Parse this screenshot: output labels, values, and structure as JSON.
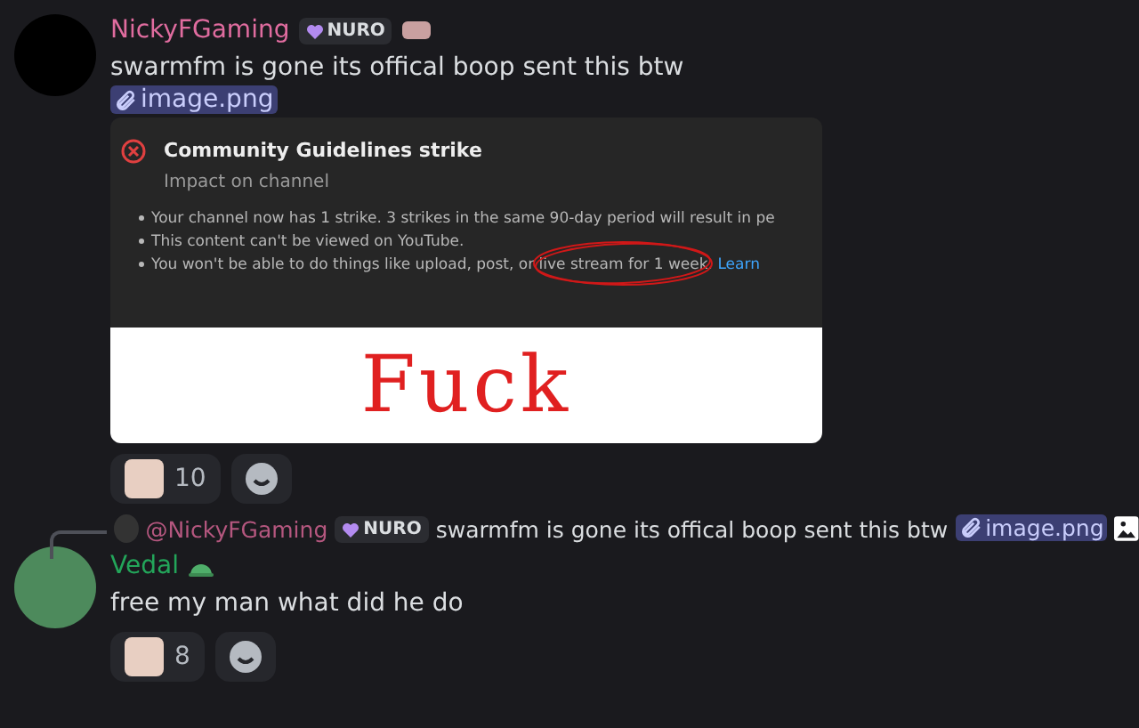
{
  "messages": [
    {
      "author": "NickyFGaming",
      "color": "#e06c9f",
      "tag": "NURO",
      "text": "swarmfm is gone its offical boop sent this btw",
      "attachment_link": "image.png",
      "embed": {
        "title": "Community Guidelines strike",
        "subtitle": "Impact on channel",
        "bullets": [
          "Your channel now has 1 strike. 3 strikes in the same 90-day period will result in pe",
          "This content can't be viewed on YouTube.",
          "You won't be able to do things like upload, post, or live stream for 1 week."
        ],
        "link": "Learn",
        "scrawl": "Fuck"
      },
      "reactions": [
        {
          "count": "10"
        }
      ]
    },
    {
      "reply": {
        "author": "@NickyFGaming",
        "tag": "NURO",
        "text": "swarmfm is gone its offical boop sent this btw",
        "link": "image.png"
      },
      "author": "Vedal",
      "color": "#23a55a",
      "text": "free my man what did he do",
      "reactions": [
        {
          "count": "8"
        }
      ]
    }
  ]
}
